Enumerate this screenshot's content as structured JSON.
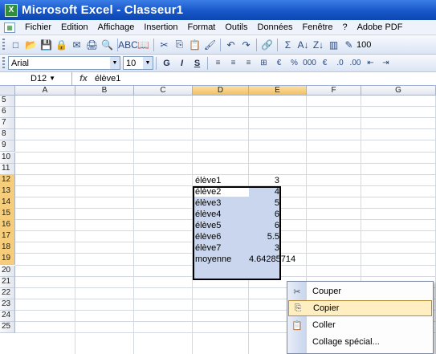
{
  "window": {
    "title": "Microsoft Excel - Classeur1",
    "app_icon": "excel-icon"
  },
  "menubar": {
    "doc_icon": "document-icon",
    "items": [
      "Fichier",
      "Edition",
      "Affichage",
      "Insertion",
      "Format",
      "Outils",
      "Données",
      "Fenêtre",
      "?",
      "Adobe PDF"
    ]
  },
  "toolbar": {
    "icons": [
      "new-file-icon",
      "open-folder-icon",
      "save-icon",
      "permissions-icon",
      "email-icon",
      "print-icon",
      "print-preview-icon",
      "spell-check-icon",
      "research-icon",
      "cut-icon",
      "copy-icon",
      "paste-icon",
      "format-painter-icon",
      "undo-icon",
      "redo-icon",
      "hyperlink-icon",
      "autosum-icon",
      "sort-ascending-icon",
      "sort-descending-icon",
      "chart-wizard-icon",
      "drawing-icon"
    ],
    "icon_glyphs": [
      "□",
      "📂",
      "💾",
      "🔒",
      "✉",
      "🖨",
      "🔍",
      "ABC",
      "📖",
      "✂",
      "⎘",
      "📋",
      "🖌",
      "↶",
      "↷",
      "🔗",
      "Σ",
      "A↓",
      "Z↓",
      "▥",
      "✎"
    ],
    "zoom": "100"
  },
  "format_toolbar": {
    "font_name": "Arial",
    "font_size": "10",
    "bold": "G",
    "italic": "I",
    "underline": "S",
    "icons": [
      "align-left-icon",
      "align-center-icon",
      "align-right-icon",
      "merge-center-icon",
      "currency-icon",
      "percent-icon",
      "thousands-icon",
      "euro-icon",
      "increase-decimal-icon",
      "decrease-decimal-icon",
      "decrease-indent-icon",
      "increase-indent-icon"
    ],
    "icon_glyphs": [
      "≡",
      "≡",
      "≡",
      "⊞",
      "€",
      "%",
      "000",
      "€",
      ".0",
      ".00",
      "⇤",
      "⇥"
    ]
  },
  "formula_bar": {
    "name_box": "D12",
    "fx": "fx",
    "content": "élève1"
  },
  "grid": {
    "columns": [
      "A",
      "B",
      "C",
      "D",
      "E",
      "F",
      "G"
    ],
    "rows": [
      "5",
      "6",
      "7",
      "8",
      "9",
      "10",
      "11",
      "12",
      "13",
      "14",
      "15",
      "16",
      "17",
      "18",
      "19",
      "20",
      "21",
      "22",
      "23",
      "24",
      "25"
    ],
    "cells": [
      {
        "label": "élève1",
        "value": "3"
      },
      {
        "label": "élève2",
        "value": "4"
      },
      {
        "label": "élève3",
        "value": "5"
      },
      {
        "label": "élève4",
        "value": "6"
      },
      {
        "label": "élève5",
        "value": "6"
      },
      {
        "label": "élève6",
        "value": "5.5"
      },
      {
        "label": "élève7",
        "value": "3"
      },
      {
        "label": "moyenne",
        "value": "4.64285714"
      }
    ]
  },
  "context_menu": {
    "items": [
      {
        "label": "Couper",
        "icon": "cut-icon",
        "glyph": "✂"
      },
      {
        "label": "Copier",
        "icon": "copy-icon",
        "glyph": "⎘"
      },
      {
        "label": "Coller",
        "icon": "paste-icon",
        "glyph": "📋"
      },
      {
        "label": "Collage spécial...",
        "icon": "",
        "glyph": ""
      }
    ]
  }
}
